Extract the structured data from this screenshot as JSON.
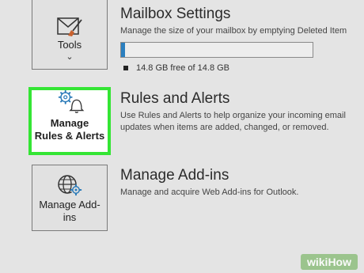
{
  "tools": {
    "label": "Tools",
    "chevron": "⌄",
    "icon": "envelope-brush-icon"
  },
  "rules_button": {
    "line1": "Manage",
    "line2": "Rules & Alerts",
    "icon": "gear-bell-icon",
    "highlight": "#34e534"
  },
  "addins_button": {
    "line1": "Manage Add-",
    "line2": "ins",
    "icon": "globe-gear-icon"
  },
  "mailbox": {
    "title": "Mailbox Settings",
    "description": "Manage the size of your mailbox by emptying Deleted Item",
    "quota_text": "14.8 GB free of 14.8 GB",
    "used_fraction": 0.02,
    "bar_color": "#2b7fbf"
  },
  "rules": {
    "title": "Rules and Alerts",
    "description": "Use Rules and Alerts to help organize your incoming email updates when items are added, changed, or removed."
  },
  "addins": {
    "title": "Manage Add-ins",
    "description": "Manage and acquire Web Add-ins for Outlook."
  },
  "watermark": "wikiHow"
}
